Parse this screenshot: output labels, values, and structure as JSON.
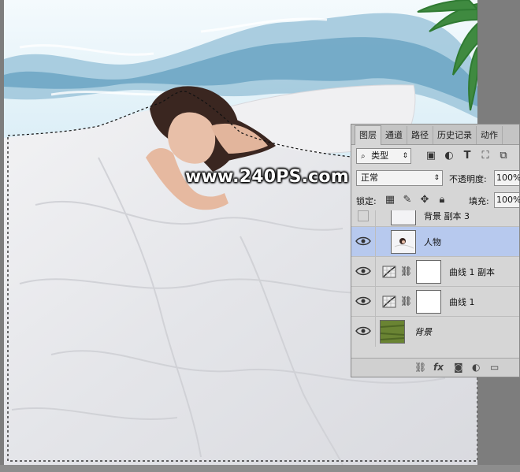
{
  "watermark": "www.240PS.com",
  "layers_panel": {
    "tabs": [
      "图层",
      "通道",
      "路径",
      "历史记录",
      "动作"
    ],
    "filter_label": "类型",
    "blend_mode": "正常",
    "opacity_label": "不透明度:",
    "opacity_value": "100%",
    "lock_label": "锁定:",
    "fill_label": "填充:",
    "fill_value": "100%",
    "layers": [
      {
        "name": "背景 副本 3",
        "visible": false,
        "selected": false,
        "kind": "pixel"
      },
      {
        "name": "人物",
        "visible": true,
        "selected": true,
        "kind": "pixel"
      },
      {
        "name": "曲线 1 副本",
        "visible": true,
        "selected": false,
        "kind": "curves"
      },
      {
        "name": "曲线 1",
        "visible": true,
        "selected": false,
        "kind": "curves"
      },
      {
        "name": "背景",
        "visible": true,
        "selected": false,
        "kind": "background"
      }
    ],
    "footer_icons": [
      "link-icon",
      "fx-icon",
      "mask-icon",
      "adjustment-icon",
      "folder-icon"
    ]
  },
  "colors": {
    "canvas_bg": "#7d7d7d",
    "panel_bg": "#d6d6d6",
    "selected_layer": "#b7c9ee",
    "water": "#4a8fb5",
    "sky": "#d8ecf4"
  }
}
